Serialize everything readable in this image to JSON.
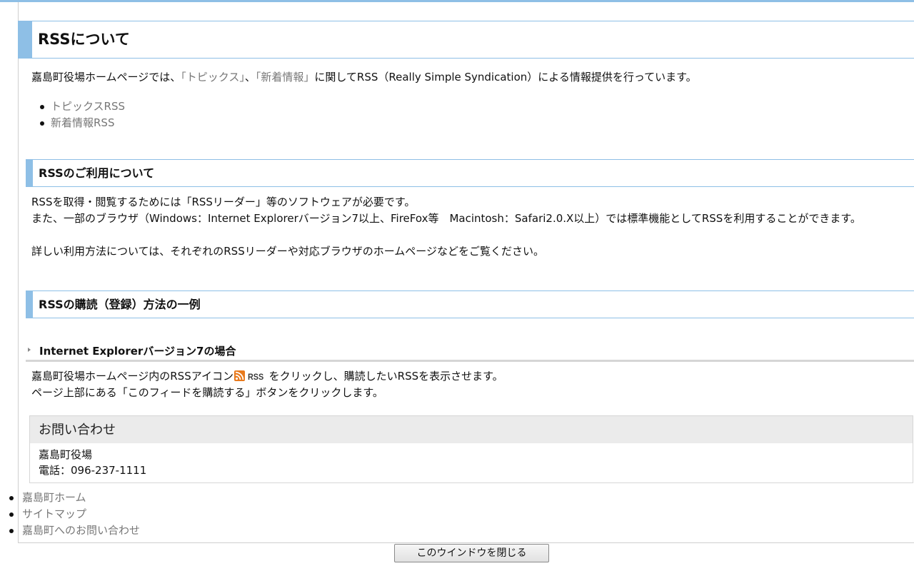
{
  "page": {
    "title": "RSSについて",
    "intro": {
      "before": "嘉島町役場ホームページでは、",
      "link1": "「トピックス」",
      "sep": "、",
      "link2": "「新着情報」",
      "after": "に関してRSS（Really Simple Syndication）による情報提供を行っています。"
    },
    "rss_links": [
      "トピックスRSS",
      "新着情報RSS"
    ]
  },
  "section_usage": {
    "heading": "RSSのご利用について",
    "line1": "RSSを取得・閲覧するためには「RSSリーダー」等のソフトウェアが必要です。",
    "line2": "また、一部のブラウザ（Windows：Internet Explorerバージョン7以上、FireFox等　Macintosh：Safari2.0.X以上）では標準機能としてRSSを利用することができます。",
    "line3": "詳しい利用方法については、それぞれのRSSリーダーや対応ブラウザのホームページなどをご覧ください。"
  },
  "section_subscribe": {
    "heading": "RSSの購読（登録）方法の一例",
    "subheading": "Internet Explorerバージョン7の場合",
    "line1_before": "嘉島町役場ホームページ内のRSSアイコン",
    "rss_word": "RSS",
    "line1_after": "をクリックし、購読したいRSSを表示させます。",
    "line2": "ページ上部にある「このフィードを購読する」ボタンをクリックします。"
  },
  "contact": {
    "heading": "お問い合わせ",
    "office": "嘉島町役場",
    "phone": "電話：096-237-1111"
  },
  "footer_links": [
    "嘉島町ホーム",
    "サイトマップ",
    "嘉島町へのお問い合わせ"
  ],
  "close_button": "このウインドウを閉じる",
  "colors": {
    "accent": "#8ebfe6",
    "link": "#777777",
    "rss_orange": "#e87a1d"
  },
  "icons": {
    "rss": "rss-feed-icon",
    "subheading_marker": "triangle-right-icon"
  }
}
